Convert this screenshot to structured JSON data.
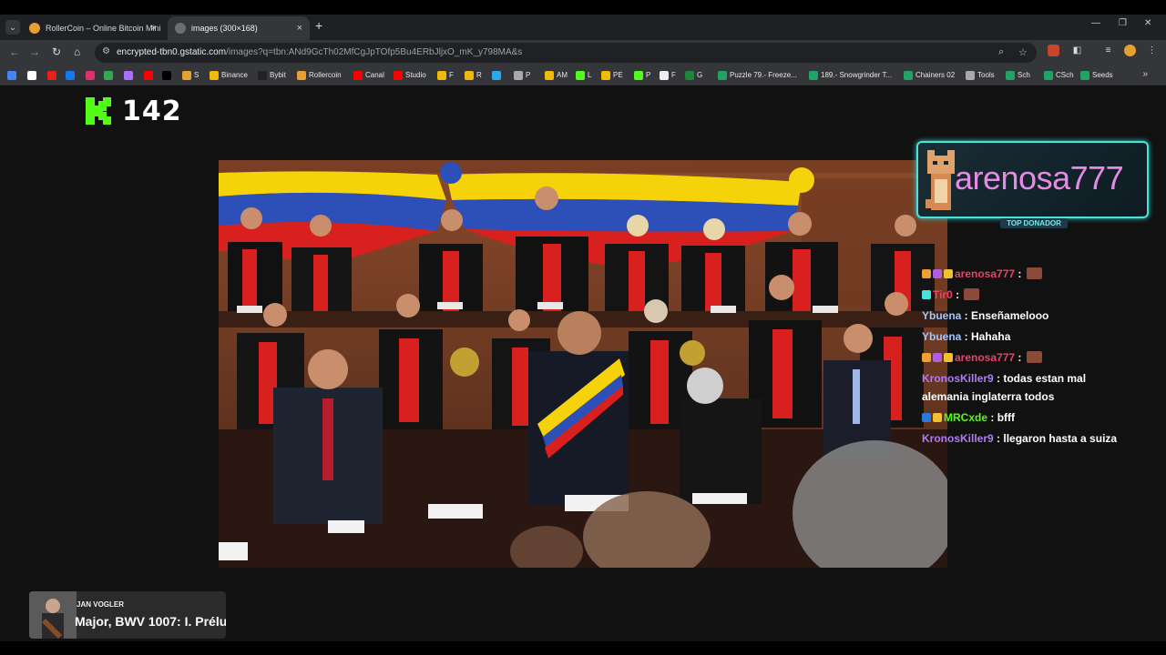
{
  "browser": {
    "tabs": [
      {
        "label": "RollerCoin – Online Bitcoin Mini",
        "favicon_color": "#e7a030"
      },
      {
        "label": "images (300×168)",
        "favicon_color": "#9aa0a6"
      }
    ],
    "new_tab": "+",
    "tab_close": "×",
    "window": {
      "minimize": "—",
      "restore": "❐",
      "close": "✕"
    },
    "url_host": "encrypted-tbn0.gstatic.com",
    "url_path": "/images?q=tbn:ANd9GcTh02MfCgJpTOfp5Bu4ERbJljxO_mK_y798MA&s",
    "bookmarks": [
      {
        "label": "",
        "color": "#4285f4"
      },
      {
        "label": "",
        "color": "#fff"
      },
      {
        "label": "",
        "color": "#e62117"
      },
      {
        "label": "",
        "color": "#1877f2"
      },
      {
        "label": "",
        "color": "#e1306c"
      },
      {
        "label": "",
        "color": "#34a853"
      },
      {
        "label": "",
        "color": "#a970ff"
      },
      {
        "label": "",
        "color": "#ff0000"
      },
      {
        "label": "",
        "color": "#000"
      },
      {
        "label": "S",
        "color": "#e7a030"
      },
      {
        "label": "Binance",
        "color": "#f0b90b"
      },
      {
        "label": "Bybit",
        "color": "#222"
      },
      {
        "label": "Rollercoin",
        "color": "#e7a030"
      },
      {
        "label": "Canal",
        "color": "#ff0000"
      },
      {
        "label": "Studio",
        "color": "#ff0000"
      },
      {
        "label": "F",
        "color": "#f0b90b"
      },
      {
        "label": "R",
        "color": "#f0b90b"
      },
      {
        "label": "",
        "color": "#29a9eb"
      },
      {
        "label": "P",
        "color": "#aaa"
      },
      {
        "label": "AM",
        "color": "#f0b90b"
      },
      {
        "label": "L",
        "color": "#53fc18"
      },
      {
        "label": "PE",
        "color": "#f0b90b"
      },
      {
        "label": "P",
        "color": "#53fc18"
      },
      {
        "label": "F",
        "color": "#eee"
      },
      {
        "label": "G",
        "color": "#1a8a3a"
      },
      {
        "label": "Puzzle 79.- Freeze...",
        "color": "#1fa463"
      },
      {
        "label": "189.- Snowgrinder T...",
        "color": "#1fa463"
      },
      {
        "label": "Chainers 02",
        "color": "#1fa463"
      },
      {
        "label": "Tools",
        "color": "#aaa"
      },
      {
        "label": "Sch",
        "color": "#1fa463"
      },
      {
        "label": "CSch",
        "color": "#1fa463"
      },
      {
        "label": "Seeds",
        "color": "#1fa463"
      }
    ],
    "bookmarks_more": "»"
  },
  "stream": {
    "viewer_count": "142",
    "kick_color": "#53fc18",
    "top_donor": {
      "name": "arenosa777",
      "label": "TOP DONADOR"
    },
    "chat": [
      {
        "user": "arenosa777",
        "color": "#e8436a",
        "text": "",
        "badges": [
          "#f0a030",
          "#b05ee0",
          "#f0c030"
        ],
        "emote": true
      },
      {
        "user": "Tir0",
        "color": "#e8436a",
        "text": "",
        "badges": [
          "#4be3d9"
        ],
        "emote": true
      },
      {
        "user": "Ybuena",
        "color": "#9fc6ff",
        "text": "Enseñamelooo",
        "badges": []
      },
      {
        "user": "Ybuena",
        "color": "#9fc6ff",
        "text": "Hahaha",
        "badges": []
      },
      {
        "user": "arenosa777",
        "color": "#e8436a",
        "text": "",
        "badges": [
          "#f0a030",
          "#b05ee0",
          "#f0c030"
        ],
        "emote": true
      },
      {
        "user": "KronosKiller9",
        "color": "#b07cf0",
        "text": "todas estan mal",
        "badges": []
      },
      {
        "user": "",
        "color": "#fff",
        "text": "alemania inglaterra todos",
        "badges": []
      },
      {
        "user": "MRCxde",
        "color": "#53fc18",
        "text": "bfff",
        "badges": [
          "#2b7ad9",
          "#f0c030"
        ]
      },
      {
        "user": "KronosKiller9",
        "color": "#b07cf0",
        "text": "llegaron hasta a suiza",
        "badges": []
      }
    ],
    "music": {
      "artist": "JAN VOGLER",
      "track": "Major, BWV 1007: I. Prélu"
    }
  }
}
